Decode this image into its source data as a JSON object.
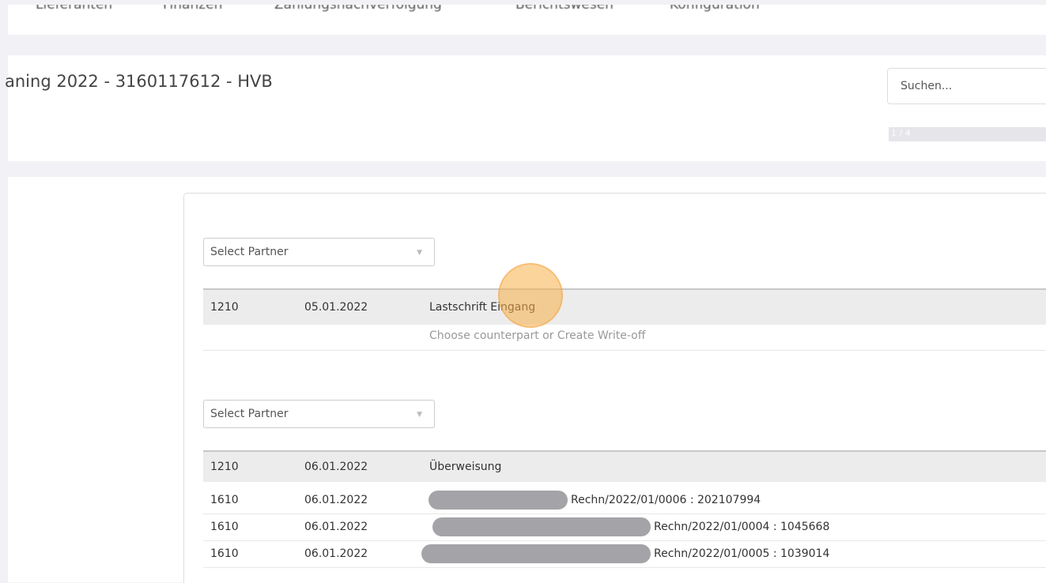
{
  "nav": {
    "items": [
      "Lieferanten",
      "Finanzen",
      "Zahlungsnachverfolgung",
      "Berichtswesen",
      "Konfiguration"
    ]
  },
  "page": {
    "title": "aning 2022 - 3160117612 - HVB"
  },
  "search": {
    "placeholder": "Suchen..."
  },
  "progress": {
    "label": "1 / 4"
  },
  "groups": [
    {
      "select": {
        "label": "Select Partner"
      },
      "header": {
        "account": "1210",
        "date": "05.01.2022",
        "description": "Lastschrift Eingang"
      },
      "hint": "Choose counterpart or Create Write-off",
      "lines": []
    },
    {
      "select": {
        "label": "Select Partner"
      },
      "header": {
        "account": "1210",
        "date": "06.01.2022",
        "description": "Überweisung"
      },
      "hint": "",
      "lines": [
        {
          "account": "1610",
          "date": "06.01.2022",
          "reference": "Rechn/2022/01/0006 : 202107994"
        },
        {
          "account": "1610",
          "date": "06.01.2022",
          "reference": "Rechn/2022/01/0004 : 1045668"
        },
        {
          "account": "1610",
          "date": "06.01.2022",
          "reference": "Rechn/2022/01/0005 : 1039014"
        }
      ]
    }
  ],
  "colors": {
    "page_bg": "#f2f2f6",
    "header_row_bg": "#ececec",
    "redaction": "#a3a3a8",
    "cursor_highlight": "#f7b048"
  }
}
